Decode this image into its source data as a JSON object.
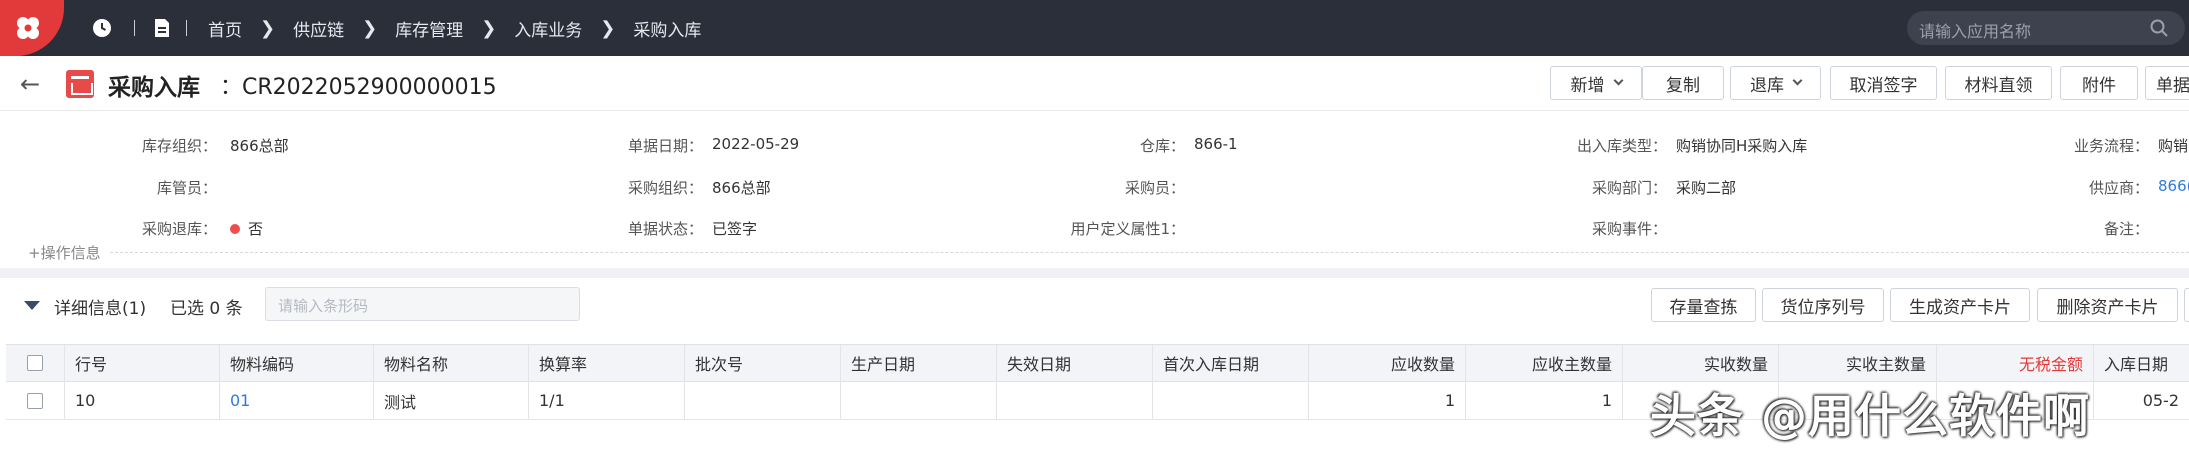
{
  "topbar": {
    "breadcrumbs": [
      "首页",
      "供应链",
      "库存管理",
      "入库业务",
      "采购入库"
    ],
    "search_placeholder": "请输入应用名称"
  },
  "header": {
    "title": "采购入库",
    "doc_no": "：CR2022052900000015",
    "buttons": [
      "新增",
      "复制",
      "退库",
      "取消签字",
      "材料直领",
      "附件",
      "单据"
    ]
  },
  "info": {
    "row1": [
      {
        "label": "库存组织：",
        "value": "866总部"
      },
      {
        "label": "单据日期：",
        "value": "2022-05-29"
      },
      {
        "label": "仓库：",
        "value": "866-1"
      },
      {
        "label": "出入库类型：",
        "value": "购销协同H采购入库"
      },
      {
        "label": "业务流程：",
        "value": "购销"
      }
    ],
    "row2": [
      {
        "label": "库管员：",
        "value": ""
      },
      {
        "label": "采购组织：",
        "value": "866总部"
      },
      {
        "label": "采购员：",
        "value": ""
      },
      {
        "label": "采购部门：",
        "value": "采购二部"
      },
      {
        "label": "供应商：",
        "value": "866("
      }
    ],
    "row3": [
      {
        "label": "采购退库：",
        "value": "否"
      },
      {
        "label": "单据状态：",
        "value": "已签字"
      },
      {
        "label": "用户定义属性1：",
        "value": ""
      },
      {
        "label": "采购事件：",
        "value": ""
      },
      {
        "label": "备注：",
        "value": ""
      }
    ],
    "op_info": "+操作信息"
  },
  "detail": {
    "title": "详细信息(1)",
    "selected": "已选 0 条",
    "barcode_placeholder": "请输入条形码",
    "buttons": [
      "存量查拣",
      "货位序列号",
      "生成资产卡片",
      "删除资产卡片"
    ]
  },
  "table": {
    "columns": [
      "行号",
      "物料编码",
      "物料名称",
      "换算率",
      "批次号",
      "生产日期",
      "失效日期",
      "首次入库日期",
      "应收数量",
      "应收主数量",
      "实收数量",
      "实收主数量",
      "无税金额",
      "入库日期"
    ],
    "rows": [
      [
        "10",
        "01",
        "测试",
        "1/1",
        "",
        "",
        "",
        "",
        "1",
        "1",
        "",
        "",
        "",
        "05-2"
      ]
    ]
  },
  "watermark": "头条 @用什么软件啊",
  "colors": {
    "accent": "#e23a3a",
    "link": "#2f7cd6",
    "topbar": "#2b2f3a"
  }
}
